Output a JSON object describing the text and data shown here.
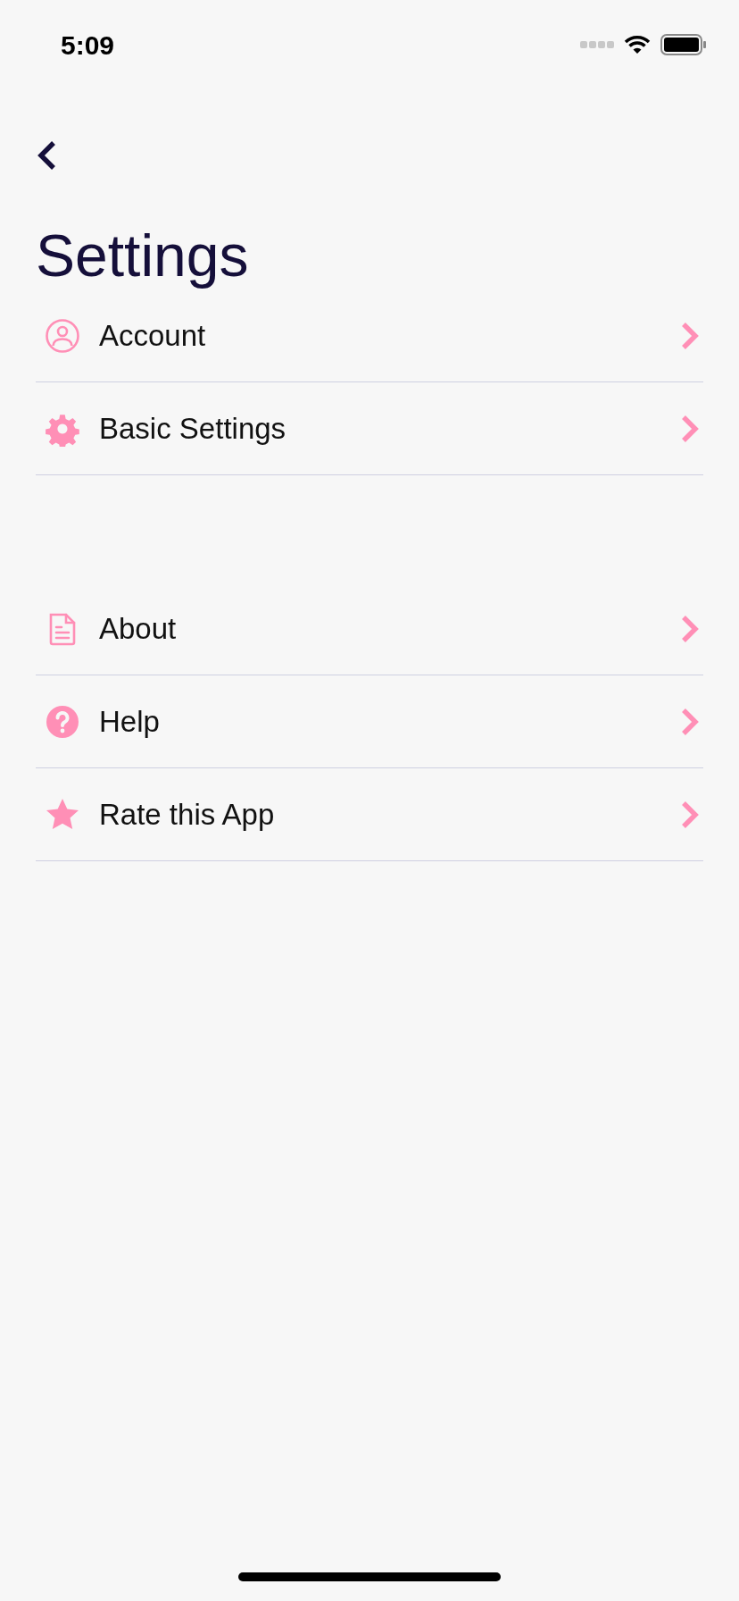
{
  "status_bar": {
    "time": "5:09"
  },
  "title": "Settings",
  "sections": [
    {
      "items": [
        {
          "label": "Account"
        },
        {
          "label": "Basic Settings"
        }
      ]
    },
    {
      "items": [
        {
          "label": "About"
        },
        {
          "label": "Help"
        },
        {
          "label": "Rate this App"
        }
      ]
    }
  ]
}
